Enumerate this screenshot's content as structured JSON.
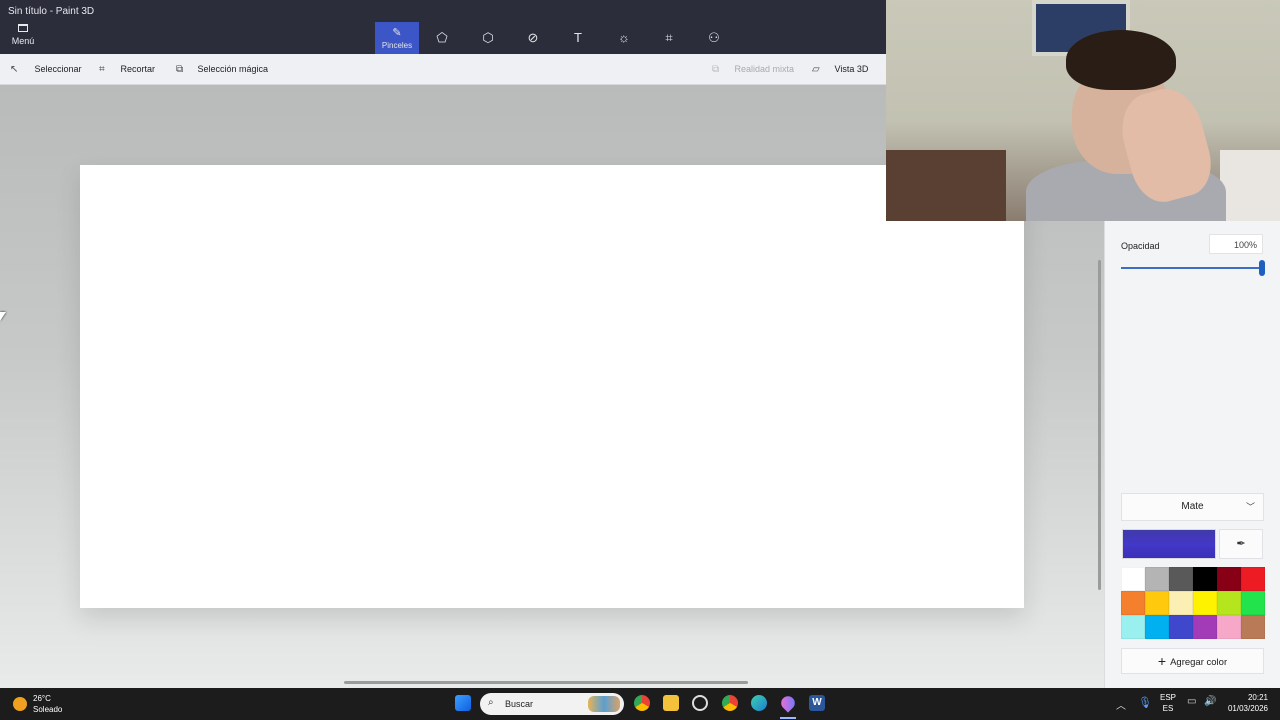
{
  "app": {
    "title": "Sin título - Paint 3D",
    "menu_label": "Menú"
  },
  "tools": [
    {
      "name": "brushes-tool",
      "icon": "brush-icon",
      "glyph": "✎",
      "label": "Pinceles",
      "active": true
    },
    {
      "name": "2d-shapes-tool",
      "icon": "2d-shapes-icon",
      "glyph": "⬠"
    },
    {
      "name": "3d-shapes-tool",
      "icon": "3d-cube-icon",
      "glyph": "⬡"
    },
    {
      "name": "stickers-tool",
      "icon": "sticker-icon",
      "glyph": "⊘"
    },
    {
      "name": "text-tool",
      "icon": "text-icon",
      "glyph": "T"
    },
    {
      "name": "effects-tool",
      "icon": "sun-icon",
      "glyph": "☼"
    },
    {
      "name": "canvas-tool",
      "icon": "crop-canvas-icon",
      "glyph": "⌗"
    },
    {
      "name": "3d-library-tool",
      "icon": "3d-library-icon",
      "glyph": "⚇"
    }
  ],
  "commands": {
    "select": "Seleccionar",
    "crop": "Recortar",
    "magic_select": "Selección mágica",
    "mixed_reality": "Realidad mixta",
    "view_3d": "Vista 3D"
  },
  "panel": {
    "opacity_label": "Opacidad",
    "opacity_value": "100%",
    "opacity_fraction": 1.0,
    "finish": "Mate",
    "current_color": "#4338c8",
    "add_color": "Agregar color",
    "palette": [
      "#ffffff",
      "#b4b4b4",
      "#595959",
      "#000000",
      "#880015",
      "#ed1c24",
      "#f47f2c",
      "#ffc90e",
      "#fbefb4",
      "#fff200",
      "#b5e61d",
      "#22e34b",
      "#99f0ee",
      "#00b0f0",
      "#3f48cc",
      "#a33bb8",
      "#f7a8c8",
      "#b97a57"
    ]
  },
  "taskbar": {
    "weather_temp": "26°C",
    "weather_text": "Soleado",
    "search_label": "Buscar",
    "lang_top": "ESP",
    "lang_bottom": "ES",
    "time": "20:21",
    "date": "01/03/2026"
  }
}
